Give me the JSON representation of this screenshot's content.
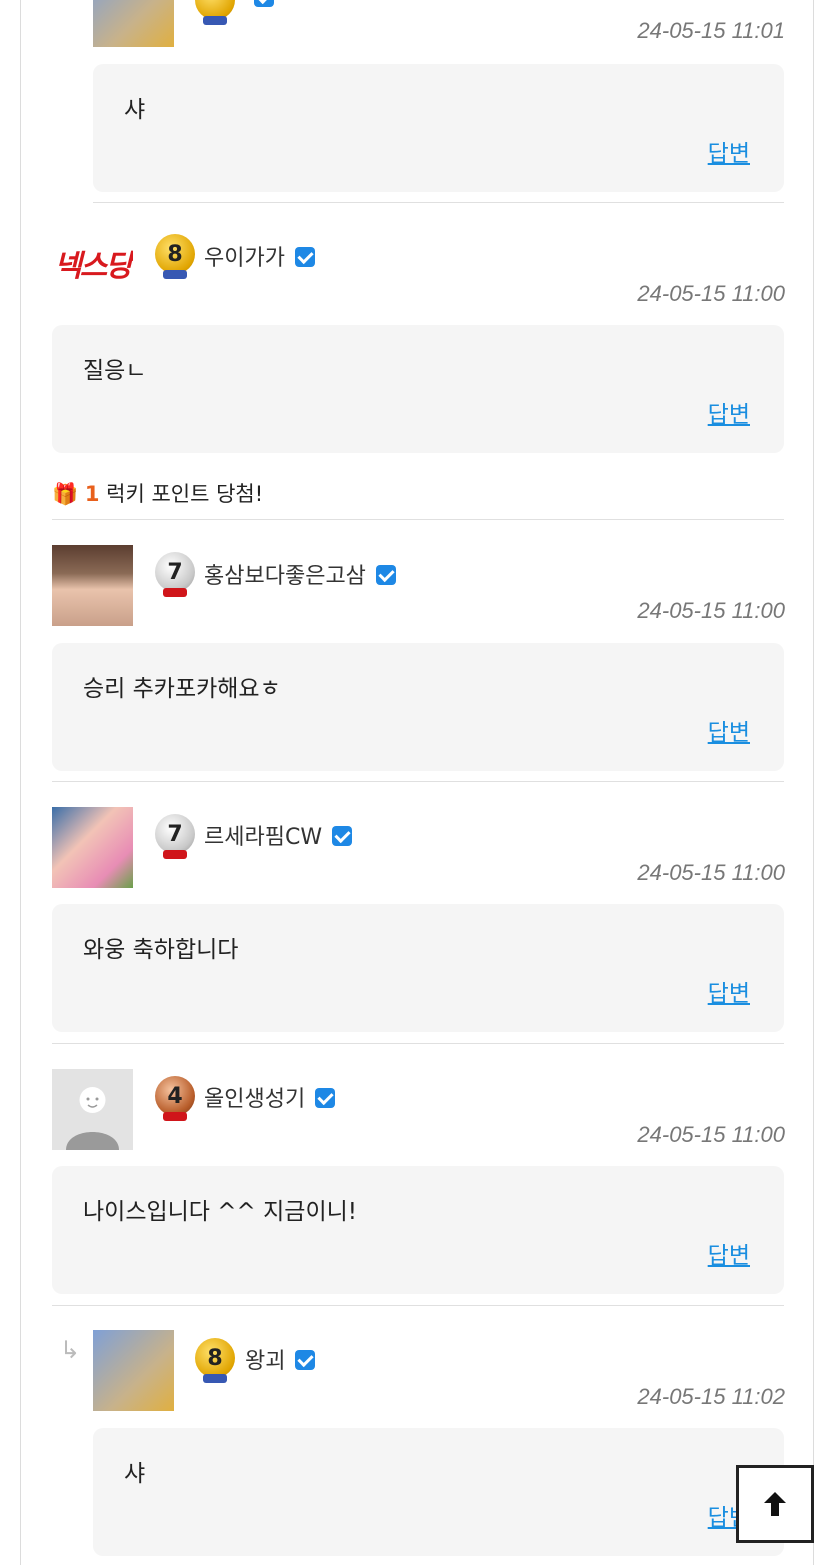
{
  "comments": [
    {
      "nick": "",
      "level": "",
      "time": "24-05-15 11:01",
      "text": "샤",
      "reply_label": "답변"
    },
    {
      "nick": "우이가가",
      "level": "8",
      "time": "24-05-15 11:00",
      "text": "질응ㄴ",
      "reply_label": "답변",
      "logo_text": "넥스당"
    },
    {
      "nick": "홍삼보다좋은고삼",
      "level": "7",
      "time": "24-05-15 11:00",
      "text": "승리 추카포카해요ㅎ",
      "reply_label": "답변"
    },
    {
      "nick": "르세라핌CW",
      "level": "7",
      "time": "24-05-15 11:00",
      "text": "와웅 축하합니다",
      "reply_label": "답변"
    },
    {
      "nick": "올인생성기",
      "level": "4",
      "time": "24-05-15 11:00",
      "text": "나이스입니다 ^^ 지금이니!",
      "reply_label": "답변"
    },
    {
      "nick": "왕괴",
      "level": "8",
      "time": "24-05-15 11:02",
      "text": "샤",
      "reply_label": "답변"
    }
  ],
  "lucky": {
    "count": "1",
    "text": "럭키 포인트 당첨!"
  },
  "colors": {
    "accent": "#1a8ee0",
    "lucky_number": "#e8601c",
    "bubble_bg": "#f5f5f5"
  }
}
